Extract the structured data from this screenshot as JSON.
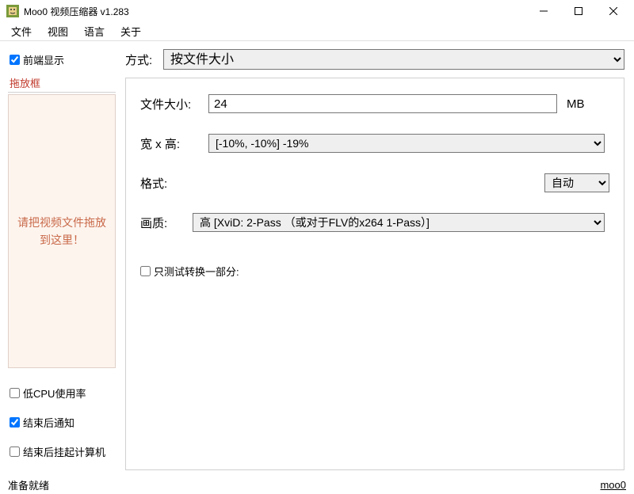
{
  "window": {
    "title": "Moo0 视频压缩器 v1.283"
  },
  "menu": {
    "file": "文件",
    "view": "视图",
    "language": "语言",
    "about": "关于"
  },
  "sidebar": {
    "always_on_top_label": "前端显示",
    "always_on_top_checked": true,
    "dropzone_label": "拖放框",
    "dropzone_hint": "请把视频文件拖放到这里！",
    "low_cpu_label": "低CPU使用率",
    "low_cpu_checked": false,
    "notify_done_label": "结束后通知",
    "notify_done_checked": true,
    "suspend_after_label": "结束后挂起计算机",
    "suspend_after_checked": false
  },
  "form": {
    "method_label": "方式:",
    "method_value": "按文件大小",
    "filesize_label": "文件大小:",
    "filesize_value": "24",
    "filesize_unit": "MB",
    "wxh_label": "宽 x 高:",
    "wxh_value": "[-10%, -10%]    -19%",
    "format_label": "格式:",
    "format_value": "自动",
    "quality_label": "画质:",
    "quality_value": "高      [XviD: 2-Pass  （或对于FLV的x264 1-Pass）]",
    "test_only_label": "只测试转换一部分:",
    "test_only_checked": false
  },
  "status": {
    "text": "准备就绪",
    "link": "moo0"
  }
}
